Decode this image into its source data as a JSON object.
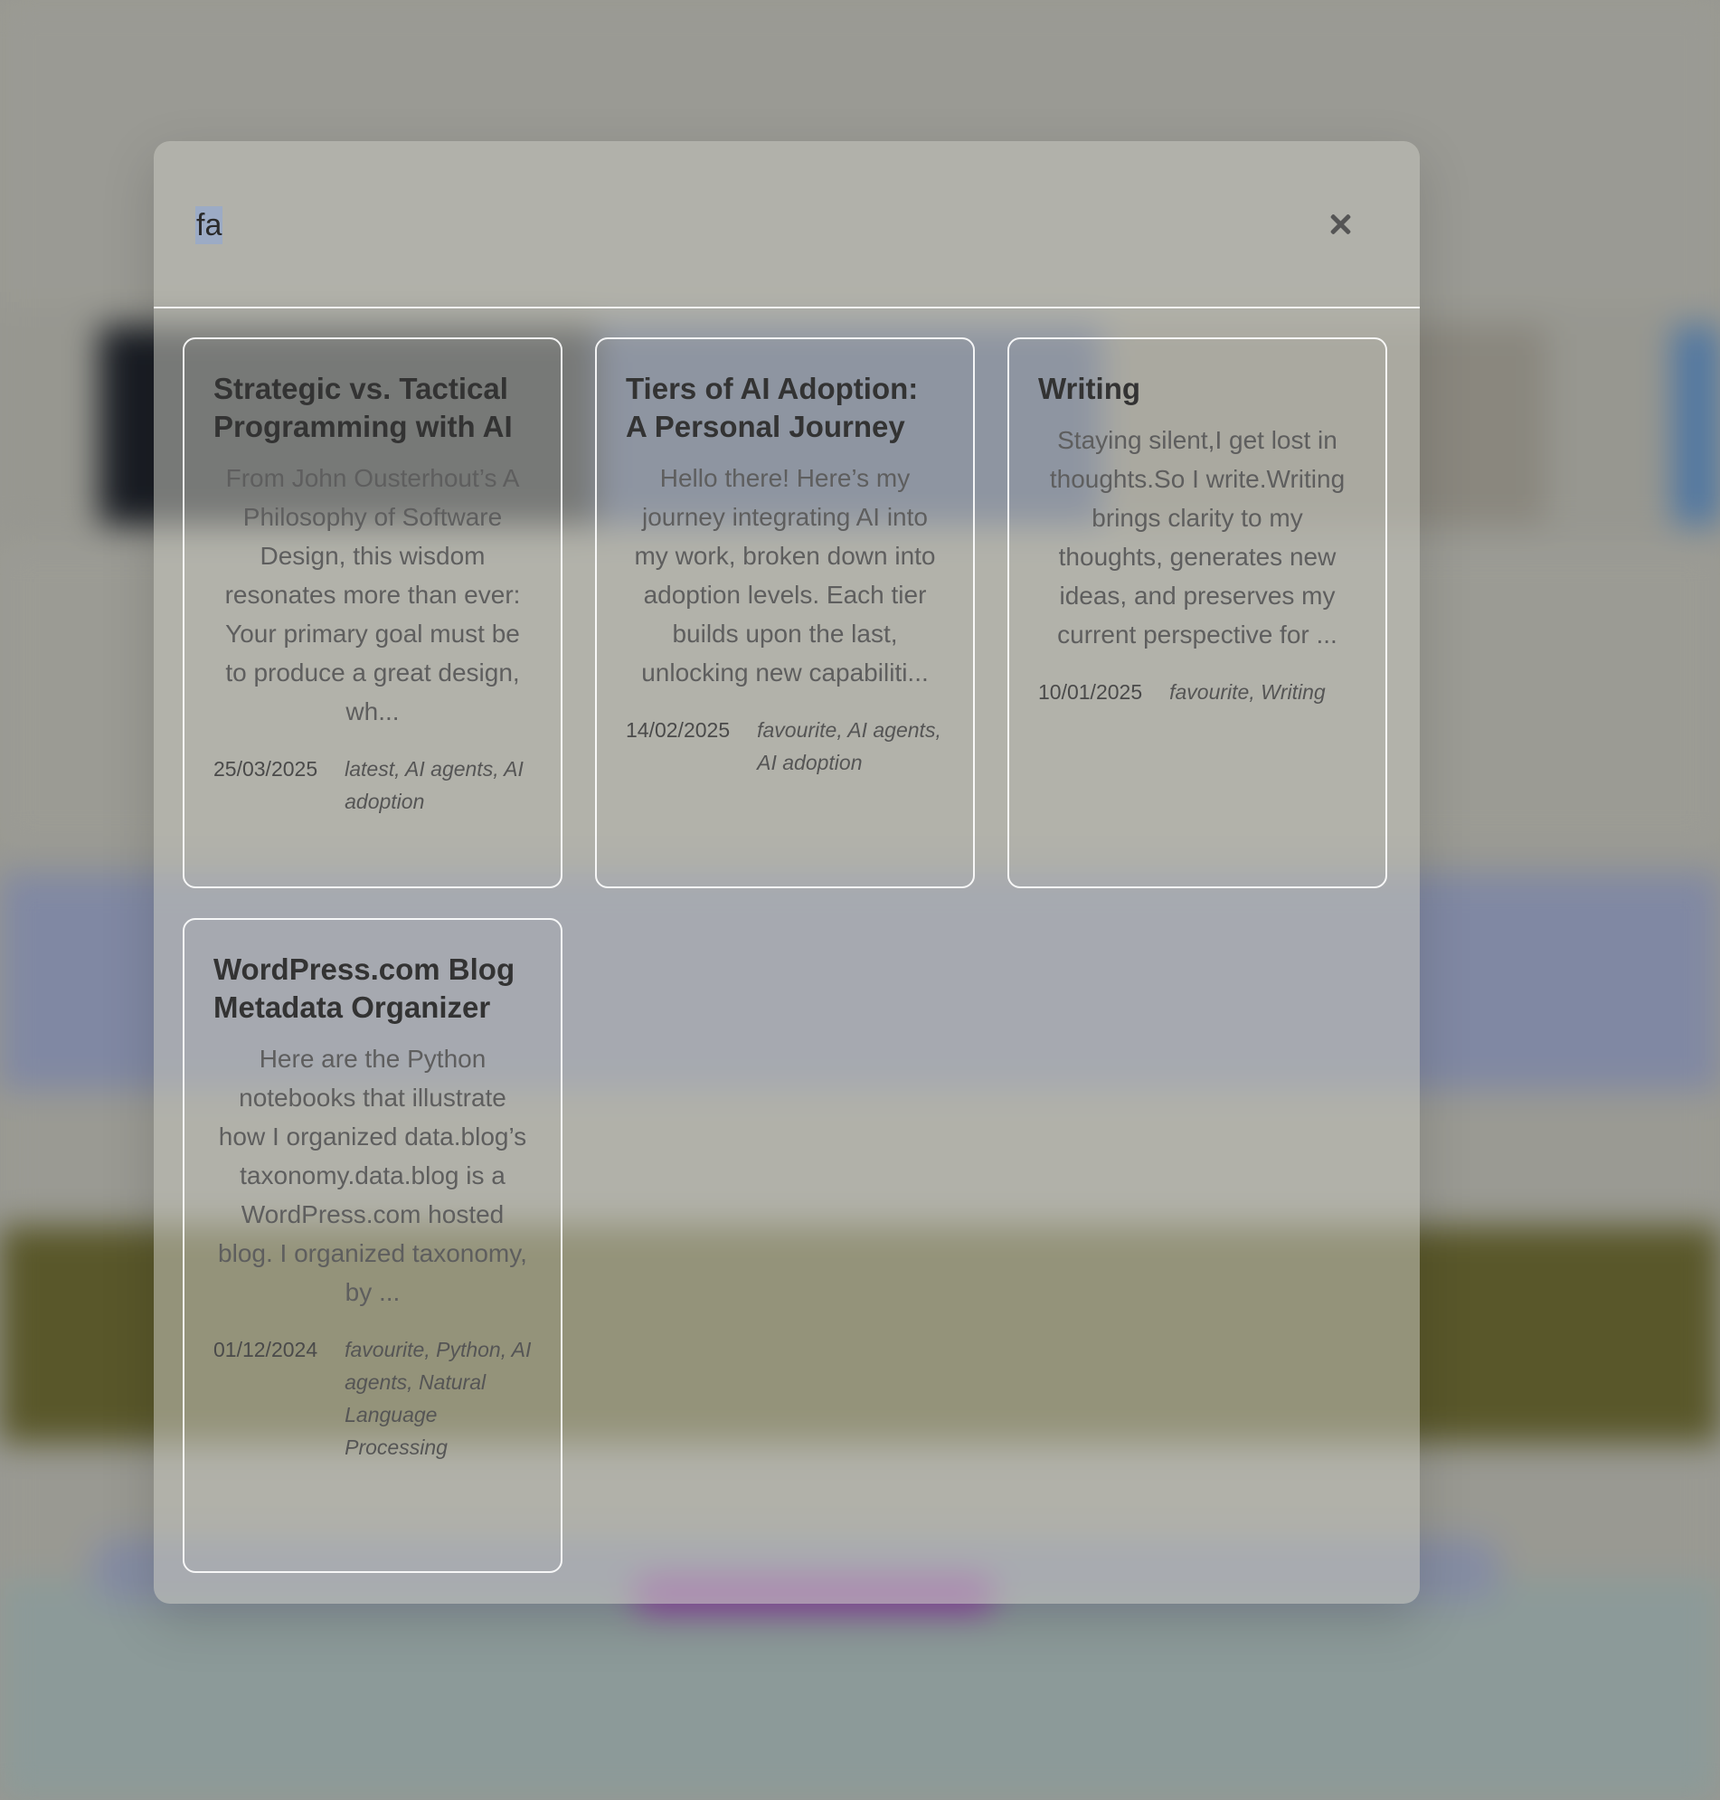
{
  "search": {
    "query": "fa"
  },
  "results": [
    {
      "title": "Strategic vs. Tactical Programming with AI",
      "excerpt": "From John Ousterhout’s A Philosophy of Software Design, this wisdom resonates more than ever: Your primary goal must be to produce a great design, wh...",
      "date": "25/03/2025",
      "tags": "latest, AI agents, AI adoption"
    },
    {
      "title": "Tiers of AI Adoption: A Personal Journey",
      "excerpt": "Hello there! Here’s my journey integrating AI into my work, broken down into adoption levels. Each tier builds upon the last, unlocking new capabiliti...",
      "date": "14/02/2025",
      "tags": "favourite, AI agents, AI adoption"
    },
    {
      "title": "Writing",
      "excerpt": "Staying silent,I get lost in thoughts.So I write.Writing brings clarity to my thoughts, generates new ideas, and preserves my current perspective for ...",
      "date": "10/01/2025",
      "tags": "favourite, Writing"
    },
    {
      "title": "WordPress.com Blog Metadata Organizer",
      "excerpt": "Here are the Python notebooks that illustrate how I organized data.blog’s taxonomy.data.blog is a WordPress.com hosted blog. I organized taxonomy, by ...",
      "date": "01/12/2024",
      "tags": "favourite, Python, AI agents, Natural Language Processing"
    }
  ]
}
